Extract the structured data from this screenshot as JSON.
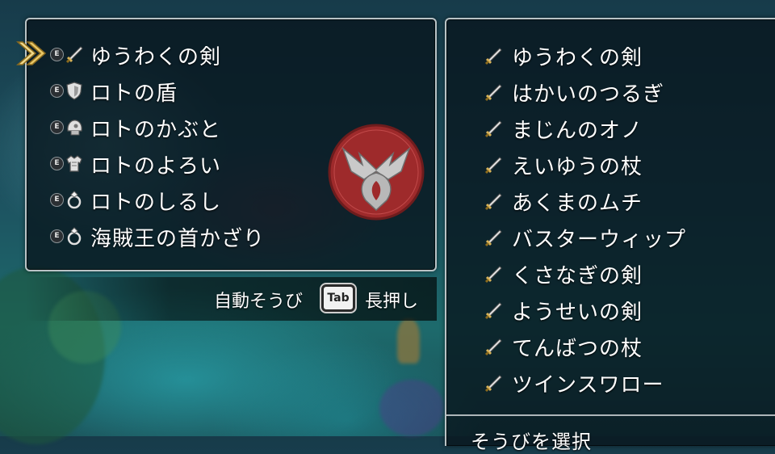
{
  "equipped": {
    "badge": "E",
    "items": [
      {
        "icon": "sword-icon",
        "label": "ゆうわくの剣"
      },
      {
        "icon": "shield-icon",
        "label": "ロトの盾"
      },
      {
        "icon": "helmet-icon",
        "label": "ロトのかぶと"
      },
      {
        "icon": "armor-icon",
        "label": "ロトのよろい"
      },
      {
        "icon": "ring-icon",
        "label": "ロトのしるし"
      },
      {
        "icon": "ring-icon",
        "label": "海賊王の首かざり"
      }
    ]
  },
  "hint": {
    "auto_equip": "自動そうび",
    "key": "Tab",
    "hold": "長押し"
  },
  "weapon_list": {
    "items": [
      {
        "icon": "sword-icon",
        "label": "ゆうわくの剣"
      },
      {
        "icon": "sword-icon",
        "label": "はかいのつるぎ"
      },
      {
        "icon": "sword-icon",
        "label": "まじんのオノ"
      },
      {
        "icon": "sword-icon",
        "label": "えいゆうの杖"
      },
      {
        "icon": "sword-icon",
        "label": "あくまのムチ"
      },
      {
        "icon": "sword-icon",
        "label": "バスターウィップ"
      },
      {
        "icon": "sword-icon",
        "label": "くさなぎの剣"
      },
      {
        "icon": "sword-icon",
        "label": "ようせいの剣"
      },
      {
        "icon": "sword-icon",
        "label": "てんばつの杖"
      },
      {
        "icon": "sword-icon",
        "label": "ツインスワロー"
      }
    ],
    "footer": "そうびを選択"
  },
  "colors": {
    "crest_red": "#9e2a2b",
    "cursor_gold": "#e9c766",
    "panel_border": "#b9c3c6"
  }
}
